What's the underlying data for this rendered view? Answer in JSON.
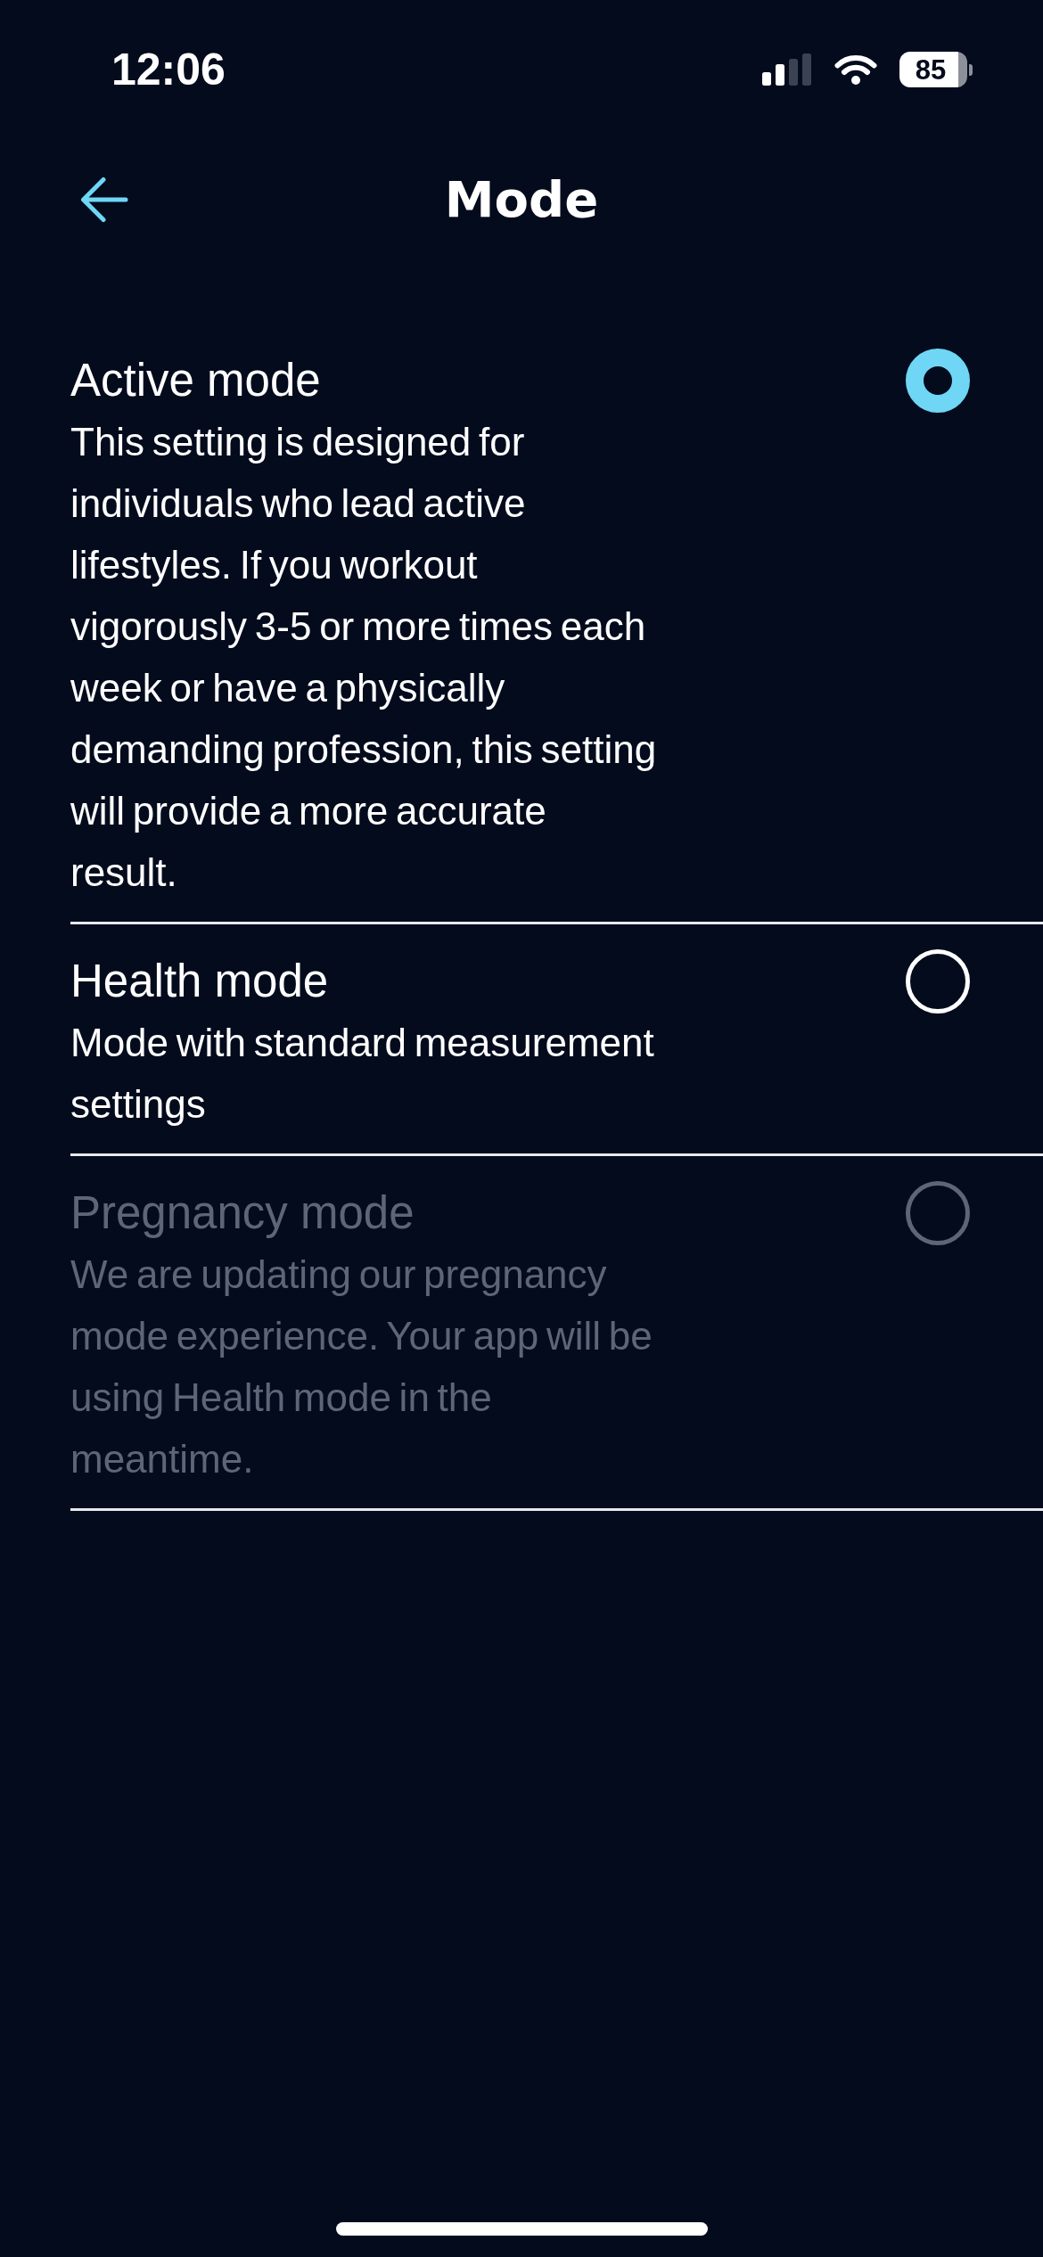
{
  "status_bar": {
    "time": "12:06",
    "battery": "85"
  },
  "header": {
    "title": "Mode"
  },
  "modes": [
    {
      "title": "Active mode",
      "description": "This setting is designed for individuals who lead active lifestyles. If you workout vigorously 3-5 or more times each week or have a physically demanding profession, this setting will provide a more accurate result.",
      "selected": true,
      "disabled": false
    },
    {
      "title": "Health mode",
      "description": "Mode with standard measurement settings",
      "selected": false,
      "disabled": false
    },
    {
      "title": "Pregnancy mode",
      "description": "We are updating our pregnancy mode experience. Your app will be using Health mode in the meantime.",
      "selected": false,
      "disabled": true
    }
  ]
}
